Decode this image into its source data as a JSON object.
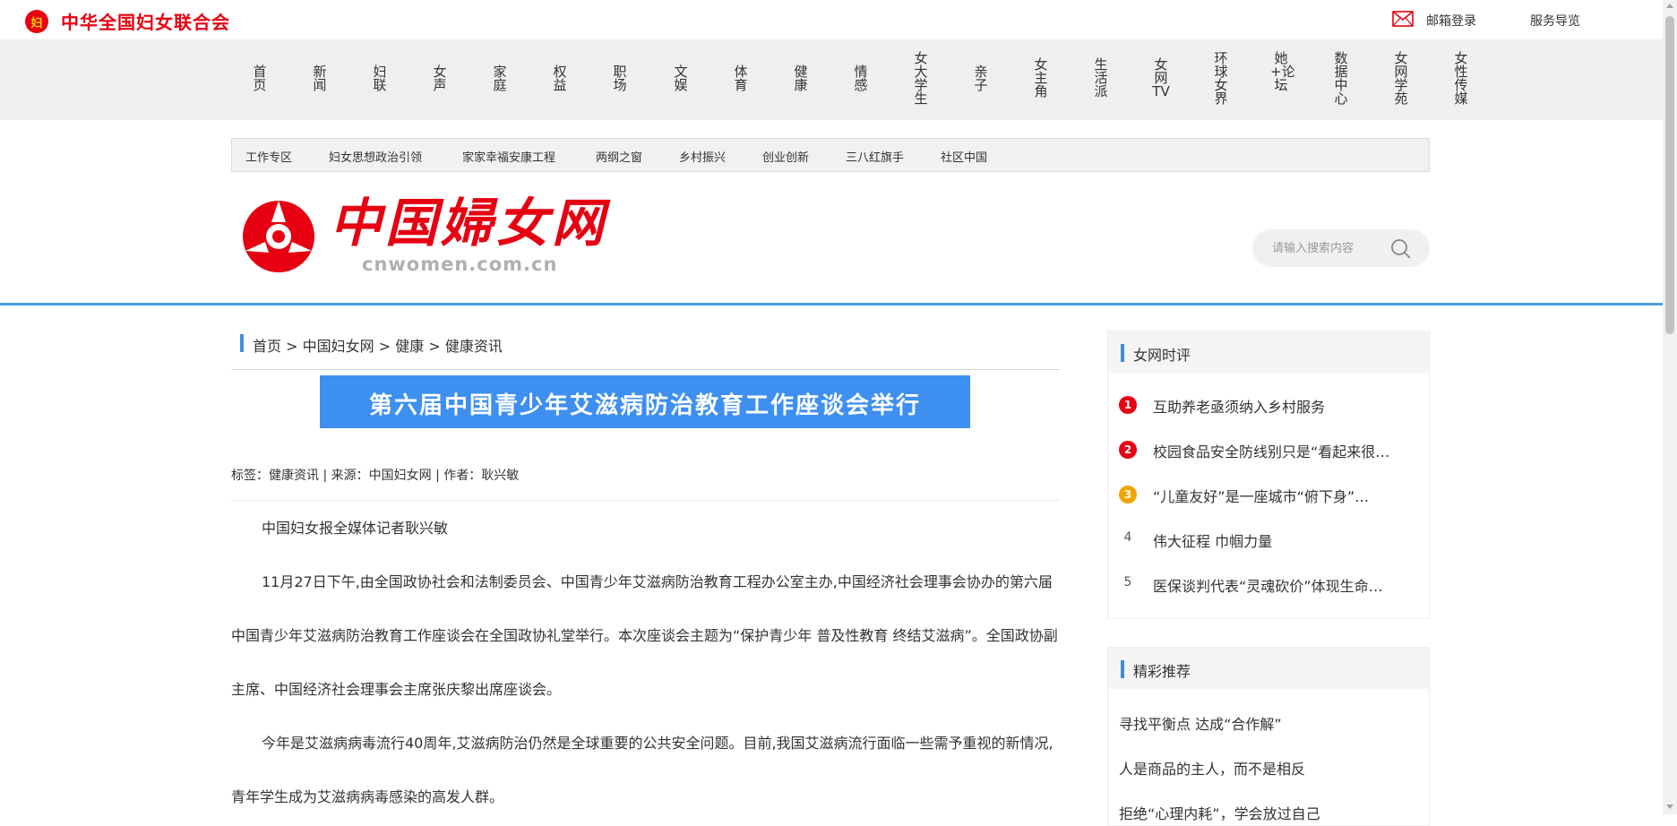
{
  "header": {
    "org_name": "中华全国妇女联合会",
    "org_logo_text": "妇",
    "mail_login": "邮箱登录",
    "service_nav": "服务导览",
    "mail_icon": "mail-icon",
    "accent_color": "#e60012"
  },
  "main_nav": [
    {
      "label": "首页"
    },
    {
      "label": "新闻"
    },
    {
      "label": "妇联"
    },
    {
      "label": "女声"
    },
    {
      "label": "家庭"
    },
    {
      "label": "权益"
    },
    {
      "label": "职场"
    },
    {
      "label": "文娱"
    },
    {
      "label": "体育"
    },
    {
      "label": "健康"
    },
    {
      "label": "情感"
    },
    {
      "label": "女大学生"
    },
    {
      "label": "亲子"
    },
    {
      "label": "女主角"
    },
    {
      "label": "生活派"
    },
    {
      "label": "女网TV"
    },
    {
      "label": "环球女界"
    },
    {
      "label": "她+论坛"
    },
    {
      "label": "数据中心"
    },
    {
      "label": "女网学苑"
    },
    {
      "label": "女性传媒"
    }
  ],
  "sub_nav": [
    {
      "label": "工作专区"
    },
    {
      "label": "妇女思想政治引领"
    },
    {
      "label": "家家幸福安康工程"
    },
    {
      "label": "两纲之窗"
    },
    {
      "label": "乡村振兴"
    },
    {
      "label": "创业创新"
    },
    {
      "label": "三八红旗手"
    },
    {
      "label": "社区中国"
    }
  ],
  "brand": {
    "title": "中国婦女网",
    "url": "cnwomen.com.cn"
  },
  "search": {
    "placeholder": "请输入搜索内容",
    "icon": "search-icon"
  },
  "breadcrumb": {
    "items": [
      "首页",
      "中国妇女网",
      "健康",
      "健康资讯"
    ],
    "separator": ">"
  },
  "article": {
    "title": "第六届中国青少年艾滋病防治教育工作座谈会举行",
    "title_highlight_color": "#3d8ff0",
    "meta": "标签：健康资讯 | 来源：中国妇女网 | 作者：耿兴敏",
    "paragraphs": [
      "中国妇女报全媒体记者耿兴敏",
      "11月27日下午,由全国政协社会和法制委员会、中国青少年艾滋病防治教育工程办公室主办,中国经济社会理事会协办的第六届中国青少年艾滋病防治教育工作座谈会在全国政协礼堂举行。本次座谈会主题为“保护青少年 普及性教育 终结艾滋病”。全国政协副主席、中国经济社会理事会主席张庆黎出席座谈会。",
      "今年是艾滋病病毒流行40周年,艾滋病防治仍然是全球重要的公共安全问题。目前,我国艾滋病流行面临一些需予重视的新情况,青年学生成为艾滋病病毒感染的高发人群。"
    ]
  },
  "sidebar": {
    "commentary": {
      "title": "女网时评",
      "items": [
        {
          "rank": "1",
          "text": "互助养老亟须纳入乡村服务",
          "badge_color": "#e60012"
        },
        {
          "rank": "2",
          "text": "校园食品安全防线别只是“看起来很…",
          "badge_color": "#e60012"
        },
        {
          "rank": "3",
          "text": "“儿童友好”是一座城市“俯下身”…",
          "badge_color": "#f0a500"
        },
        {
          "rank": "4",
          "text": "伟大征程 巾帼力量"
        },
        {
          "rank": "5",
          "text": "医保谈判代表“灵魂砍价”体现生命…"
        }
      ]
    },
    "recommend": {
      "title": "精彩推荐",
      "items": [
        {
          "text": "寻找平衡点 达成“合作解”"
        },
        {
          "text": "人是商品的主人，而不是相反"
        },
        {
          "text": "拒绝“心理内耗”，学会放过自己"
        }
      ]
    }
  }
}
